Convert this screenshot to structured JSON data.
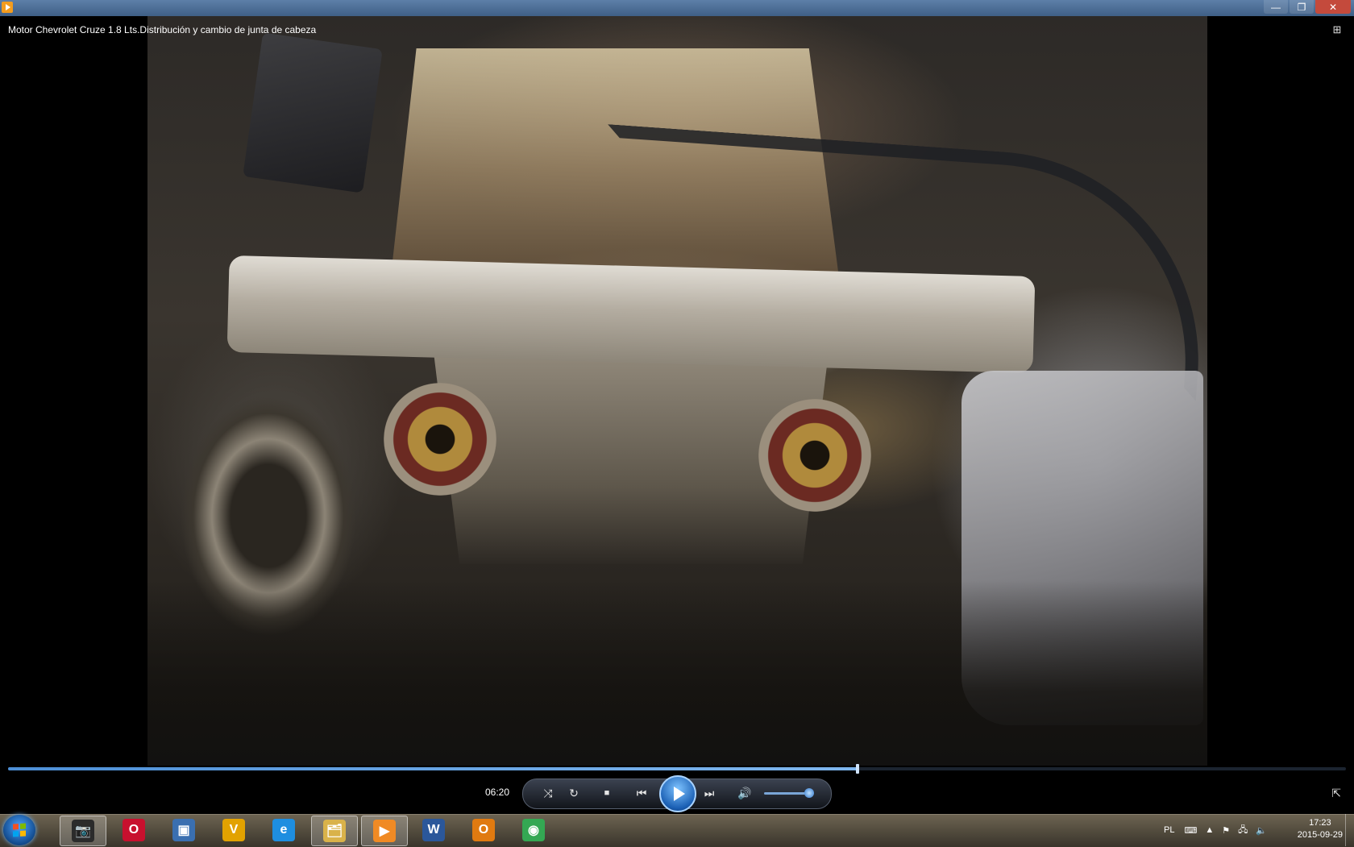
{
  "window": {
    "video_title": "Motor Chevrolet Cruze 1.8 Lts.Distribución y cambio de junta de cabeza",
    "minimize_glyph": "—",
    "restore_glyph": "❐",
    "close_glyph": "✕"
  },
  "player": {
    "elapsed_time": "06:20",
    "seek_progress": 0.635,
    "volume_level": 0.9,
    "icons": {
      "shuffle": "⤨",
      "repeat": "↻",
      "stop": "■",
      "previous": "⏮",
      "next": "⏭",
      "volume": "🔊",
      "switch_to_library": "⇱",
      "fullscreen_toggle": "⊞"
    }
  },
  "taskbar": {
    "apps": [
      {
        "name": "photo-viewer-icon",
        "glyph": "📷",
        "color": "#2b2b2b",
        "active": true
      },
      {
        "name": "opera-icon",
        "glyph": "O",
        "color": "#c8102e",
        "active": false
      },
      {
        "name": "gallery-icon",
        "glyph": "▣",
        "color": "#3a6fb0",
        "active": false
      },
      {
        "name": "vlc-like-icon",
        "glyph": "V",
        "color": "#e2a200",
        "active": false
      },
      {
        "name": "internet-explorer-icon",
        "glyph": "e",
        "color": "#1e8ee0",
        "active": false
      },
      {
        "name": "file-explorer-icon",
        "glyph": "🗂",
        "color": "#d9b24a",
        "active": true
      },
      {
        "name": "media-player-icon",
        "glyph": "▶",
        "color": "#f08a24",
        "active": true
      },
      {
        "name": "word-icon",
        "glyph": "W",
        "color": "#2b579a",
        "active": false
      },
      {
        "name": "outlook-icon",
        "glyph": "O",
        "color": "#e07a10",
        "active": false
      },
      {
        "name": "chrome-icon",
        "glyph": "◉",
        "color": "#34a853",
        "active": false
      }
    ],
    "language": "PL",
    "time": "17:23",
    "date": "2015-09-29"
  }
}
